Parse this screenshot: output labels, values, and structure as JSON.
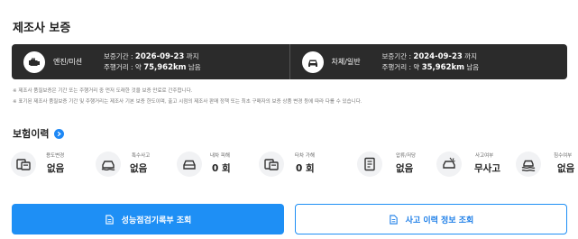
{
  "title": "제조사 보증",
  "warranty": [
    {
      "icon": "engine-icon",
      "name": "엔진/미션",
      "period_label": "보증기간 : ",
      "period_value": "2026-09-23",
      "period_suffix": " 까지",
      "distance_label": "주행거리 : 약 ",
      "distance_value": "75,962km",
      "distance_suffix": " 남음"
    },
    {
      "icon": "car-body-icon",
      "name": "차체/일반",
      "period_label": "보증기간 : ",
      "period_value": "2024-09-23",
      "period_suffix": " 까지",
      "distance_label": "주행거리 : 약 ",
      "distance_value": "35,962km",
      "distance_suffix": " 남음"
    }
  ],
  "notes": [
    "※ 제조사 품질보증은 기간 또는 주행거리 중 먼저 도래한 것을 보증 만료로 간주합니다.",
    "※ 표기된 제조사 품질보증 기간 및 주행거리는 제조사 기본 보증 한도이며, 출고 시점의 제조사 판매 정책 또는 최초 구매자의 보증 상품 변경 등에 따라 다를 수 있습니다."
  ],
  "history": {
    "title": "보험이력",
    "items": [
      {
        "icon": "use-change-icon",
        "label": "용도변경",
        "value": "없음"
      },
      {
        "icon": "special-accident-icon",
        "label": "특수사고",
        "value": "없음"
      },
      {
        "icon": "own-damage-icon",
        "label": "내차 피해",
        "value": "0 회"
      },
      {
        "icon": "other-damage-icon",
        "label": "타차 가해",
        "value": "0 회"
      },
      {
        "icon": "seizure-icon",
        "label": "압류/저당",
        "value": "없음"
      },
      {
        "icon": "accident-status-icon",
        "label": "사고여부",
        "value": "무사고"
      },
      {
        "icon": "flood-icon",
        "label": "침수여부",
        "value": "없음"
      }
    ]
  },
  "buttons": {
    "performance": "성능점검기록부 조회",
    "accident": "사고 이력 정보 조회"
  },
  "colors": {
    "accent": "#1e8ff5",
    "dark_panel": "#2b2b2b"
  }
}
